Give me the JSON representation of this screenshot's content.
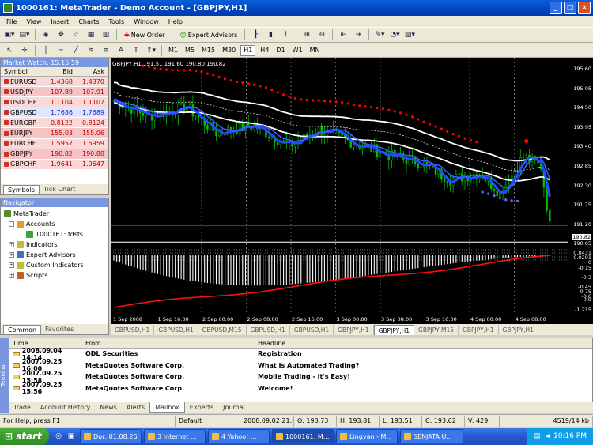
{
  "window": {
    "title": "1000161: MetaTrader - Demo Account - [GBPJPY,H1]"
  },
  "menu": [
    "File",
    "View",
    "Insert",
    "Charts",
    "Tools",
    "Window",
    "Help"
  ],
  "toolbar": {
    "new_order": "New Order",
    "expert_advisors": "Expert Advisors",
    "timeframes": [
      "M1",
      "M5",
      "M15",
      "M30",
      "H1",
      "H4",
      "D1",
      "W1",
      "MN"
    ],
    "active_timeframe": "H1"
  },
  "market_watch": {
    "title": "Market Watch: 15:15:59",
    "headers": [
      "Symbol",
      "Bid",
      "Ask"
    ],
    "rows": [
      {
        "symbol": "EURUSD",
        "bid": "1.4368",
        "ask": "1.4370"
      },
      {
        "symbol": "USDJPY",
        "bid": "107.89",
        "ask": "107.91"
      },
      {
        "symbol": "USDCHF",
        "bid": "1.1104",
        "ask": "1.1107"
      },
      {
        "symbol": "GBPUSD",
        "bid": "1.7686",
        "ask": "1.7689"
      },
      {
        "symbol": "EURGBP",
        "bid": "0.8122",
        "ask": "0.8124"
      },
      {
        "symbol": "EURJPY",
        "bid": "155.03",
        "ask": "155.06"
      },
      {
        "symbol": "EURCHF",
        "bid": "1.5957",
        "ask": "1.5959"
      },
      {
        "symbol": "GBPJPY",
        "bid": "190.82",
        "ask": "190.88"
      },
      {
        "symbol": "GBPCHF",
        "bid": "1.9641",
        "ask": "1.9647"
      }
    ],
    "tabs": [
      "Symbols",
      "Tick Chart"
    ]
  },
  "navigator": {
    "title": "Navigator",
    "items": [
      "MetaTrader",
      "Accounts",
      "1000161: fdsfs",
      "Indicators",
      "Expert Advisors",
      "Custom Indicators",
      "Scripts"
    ],
    "tabs": [
      "Common",
      "Favorites"
    ]
  },
  "chart": {
    "header": "GBPJPY,H1  191.51 191.60 190.80 190.82",
    "price_labels": [
      "195.60",
      "195.05",
      "194.50",
      "193.95",
      "193.40",
      "192.85",
      "192.30",
      "191.75",
      "191.20",
      "190.65"
    ],
    "current_price": "190.82",
    "osc_labels": [
      "0.0431",
      "0.0291",
      "0",
      "-0.15",
      "-0.3",
      "-0.45",
      "-0.6",
      "-0.75",
      "-0.9",
      "-1.215"
    ],
    "time_labels": [
      "1 Sep 2008",
      "1 Sep 16:00",
      "2 Sep 00:00",
      "2 Sep 08:00",
      "2 Sep 16:00",
      "3 Sep 00:00",
      "3 Sep 08:00",
      "3 Sep 16:00",
      "4 Sep 00:00",
      "4 Sep 08:00"
    ],
    "colors": {
      "up": "#00c000",
      "ma_blue": "#1f4cff",
      "env": "#ffffff",
      "sar": "#ff0000",
      "osc_signal": "#ff1010"
    }
  },
  "chart_tabs": [
    "GBPUSD,H1",
    "GBPUSD,H1",
    "GBPUSD,M15",
    "GBPUSD,H1",
    "GBPUSD,H1",
    "GBPJPY,H1",
    "GBPJPY,H1",
    "GBPJPY,M15",
    "GBPJPY,H1",
    "GBPJPY,H1"
  ],
  "active_chart_tab": 6,
  "terminal": {
    "side_label": "Terminal",
    "headers": [
      "Time",
      "From",
      "Headline"
    ],
    "rows": [
      {
        "time": "2008.09.04 14:14",
        "from": "ODL Securities",
        "headline": "Registration"
      },
      {
        "time": "2007.09.25 16:00",
        "from": "MetaQuotes Software Corp.",
        "headline": "What Is Automated Trading?"
      },
      {
        "time": "2007.09.25 15:58",
        "from": "MetaQuotes Software Corp.",
        "headline": "Mobile Trading - It's Easy!"
      },
      {
        "time": "2007.09.25 15:56",
        "from": "MetaQuotes Software Corp.",
        "headline": "Welcome!"
      }
    ],
    "tabs": [
      "Trade",
      "Account History",
      "News",
      "Alerts",
      "Mailbox",
      "Experts",
      "Journal"
    ],
    "active_tab": "Mailbox"
  },
  "status": {
    "help": "For Help, press F1",
    "profile": "Default",
    "datetime": "2008.09.02 21:00",
    "open": "O: 193.73",
    "high": "H: 193.81",
    "low": "L: 193.51",
    "close": "C: 193.62",
    "volume": "V: 429",
    "traffic": "4519/14 kb"
  },
  "taskbar": {
    "start": "start",
    "tasks": [
      "Dur: 01:08:26",
      "3 Internet ...",
      "4 Yahoo! ...",
      "1000161: M...",
      "Lingyan - M...",
      "SENJATA U..."
    ],
    "clock": "10:16 PM"
  }
}
